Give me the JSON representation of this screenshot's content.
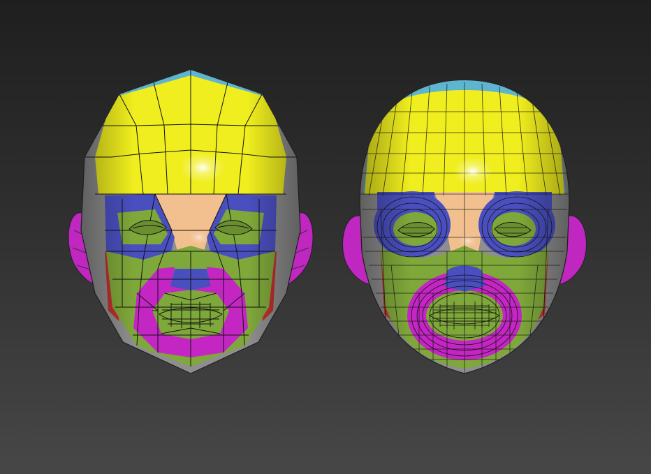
{
  "viewport": {
    "background_top": "#1f1f1f",
    "background_bottom": "#474747"
  },
  "models": [
    {
      "name": "low-poly-head",
      "topology": "low"
    },
    {
      "name": "subdivided-head",
      "topology": "high"
    }
  ],
  "palette": {
    "crown": "#5fb4cf",
    "skull": "#f0ee1e",
    "forehead_skin": "#f2c08f",
    "eye_ring": "#4a4fbf",
    "eye_inner": "#7fa83a",
    "cheek": "#7fa83a",
    "mouth_ring": "#c426c4",
    "jaw_side": "#c03030",
    "ear": "#c026c0",
    "head_side": "#8e8e8e",
    "wire": "#111111"
  }
}
